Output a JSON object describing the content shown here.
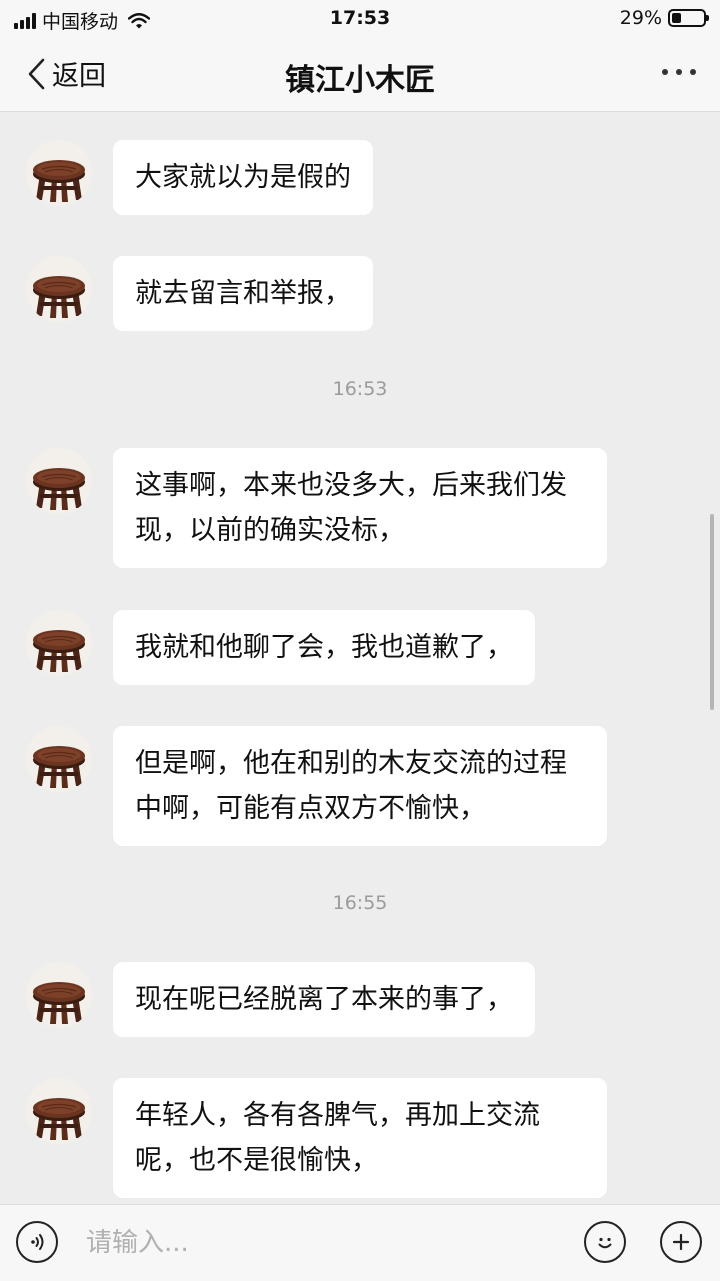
{
  "status_bar": {
    "carrier": "中国移动",
    "time": "17:53",
    "battery_percent": "29%",
    "battery_level": 0.29
  },
  "nav": {
    "back_label": "返回",
    "title": "镇江小木匠",
    "more_icon": "more-icon"
  },
  "messages": [
    {
      "text": "大家就以为是假的"
    },
    {
      "text": "就去留言和举报，"
    },
    {
      "timestamp": "16:53"
    },
    {
      "text": "这事啊，本来也没多大，后来我们发现，以前的确实没标，"
    },
    {
      "text": "我就和他聊了会，我也道歉了，"
    },
    {
      "text": "但是啊，他在和别的木友交流的过程中啊，可能有点双方不愉快，"
    },
    {
      "timestamp": "16:55"
    },
    {
      "text": "现在呢已经脱离了本来的事了，"
    },
    {
      "text": "年轻人，各有各脾气，再加上交流呢，也不是很愉快，"
    }
  ],
  "input_bar": {
    "placeholder": "请输入...",
    "voice_icon": "voice-icon",
    "emoji_icon": "emoji-icon",
    "plus_icon": "plus-icon"
  },
  "colors": {
    "background": "#ededed",
    "bubble": "#ffffff",
    "bar": "#f7f7f7",
    "timestamp": "#9b9b9b"
  }
}
